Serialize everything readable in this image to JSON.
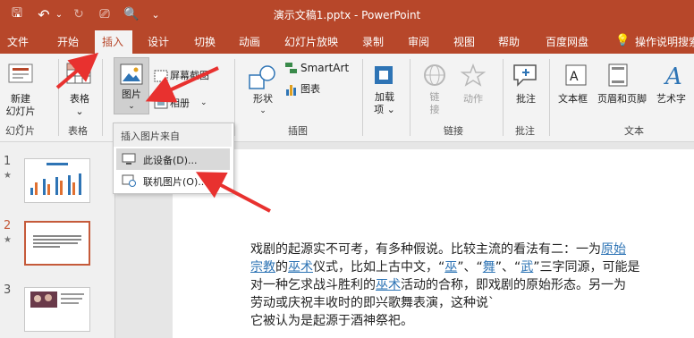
{
  "window": {
    "title": "演示文稿1.pptx  -  PowerPoint",
    "qat": {
      "save": "🖫",
      "undo": "↶",
      "redo": "↻",
      "present": "⎚",
      "print_preview": "🔍",
      "customize": "⌄"
    }
  },
  "tabs": [
    "文件",
    "开始",
    "插入",
    "设计",
    "切换",
    "动画",
    "幻灯片放映",
    "录制",
    "审阅",
    "视图",
    "帮助",
    "百度网盘"
  ],
  "active_tab": "插入",
  "tell_me": "操作说明搜索",
  "ribbon": {
    "slides": {
      "button": "新建\n幻灯片 ⌄",
      "label": "幻灯片"
    },
    "tables": {
      "button": "表格\n⌄",
      "label": "表格"
    },
    "images": {
      "pictures": "图片",
      "pictures_arrow": "⌄",
      "screenshot": "屏幕截图",
      "album": "相册",
      "album_arrow": "⌄"
    },
    "illustrations": {
      "shapes": "形状",
      "shapes_arrow": "⌄",
      "smartart": "SmartArt",
      "chart": "图表",
      "label": "插图"
    },
    "addins": {
      "button": "加载\n项 ⌄"
    },
    "links": {
      "link": "链\n接",
      "action": "动作",
      "label": "链接"
    },
    "comments": {
      "button": "批注",
      "label": "批注"
    },
    "text": {
      "textbox": "文本框",
      "header_footer": "页眉和页脚",
      "wordart": "艺术字",
      "label": "文本"
    }
  },
  "dropdown": {
    "header": "插入图片来自",
    "items": [
      "此设备(D)...",
      "联机图片(O)..."
    ]
  },
  "thumbnails": [
    {
      "num": "1",
      "star": "★"
    },
    {
      "num": "2",
      "star": "★"
    },
    {
      "num": "3",
      "star": ""
    }
  ],
  "slide_text": {
    "l1a": "戏剧的起源实不可考，有多种假说。比较主流的看法有二：一为",
    "l1b": "原始",
    "l2a": "宗教",
    "l2b": "的",
    "l2c": "巫术",
    "l2d": "仪式，比如上古中文，“",
    "l2e": "巫",
    "l2f": "”、“",
    "l2g": "舞",
    "l2h": "”、“",
    "l2i": "武",
    "l2j": "”三字同源，可能是",
    "l3a": "对一种乞求战斗胜利的",
    "l3b": "巫术",
    "l3c": "活动的合称，即戏剧的原始形态。另一为",
    "l4": "劳动或庆祝丰收时的即兴歌舞表演，这种说`",
    "l5": "它被认为是起源于酒神祭祀。"
  },
  "colors": {
    "accent": "#b7472a",
    "link": "#2e74b5",
    "arrow": "#e8312f"
  }
}
